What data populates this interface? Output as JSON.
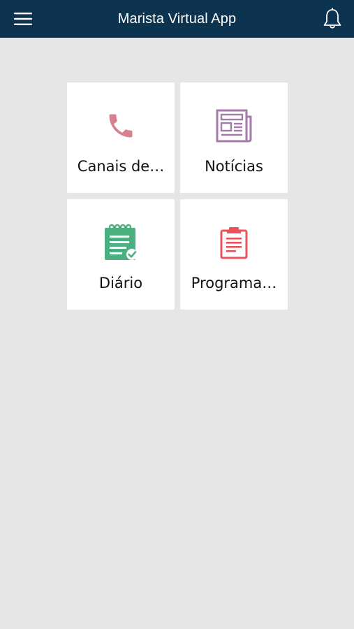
{
  "header": {
    "title": "Marista Virtual App",
    "menu_icon": "hamburger-menu-icon",
    "notification_icon": "bell-icon"
  },
  "tiles": [
    {
      "label": "Canais de…",
      "icon": "phone-icon",
      "color": "#d9808f"
    },
    {
      "label": "Notícias",
      "icon": "newspaper-icon",
      "color": "#a47aaa"
    },
    {
      "label": "Diário",
      "icon": "notepad-check-icon",
      "color": "#4caf7f"
    },
    {
      "label": "Programa…",
      "icon": "clipboard-icon",
      "color": "#e8535a"
    }
  ],
  "colors": {
    "header_bg": "#0c3350",
    "page_bg": "#e6e6e6",
    "tile_bg": "#ffffff"
  }
}
